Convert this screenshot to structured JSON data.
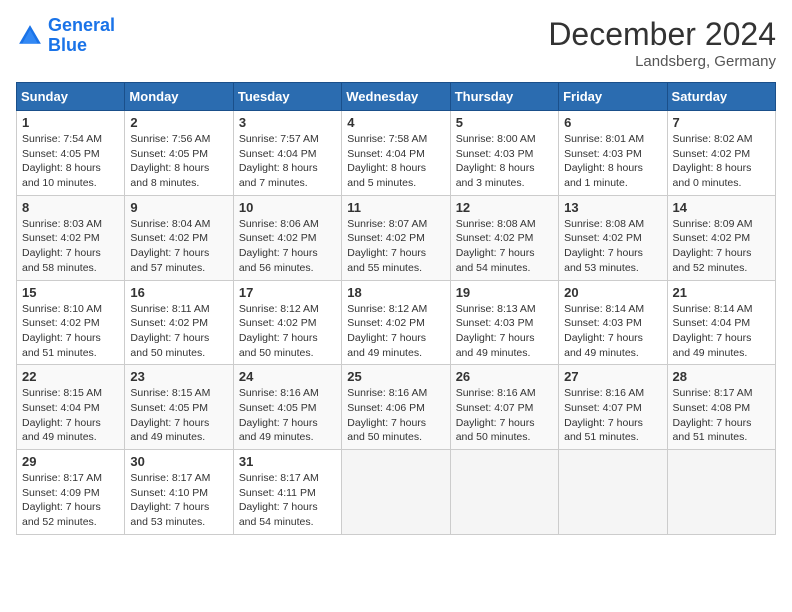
{
  "logo": {
    "line1": "General",
    "line2": "Blue"
  },
  "title": "December 2024",
  "location": "Landsberg, Germany",
  "days_header": [
    "Sunday",
    "Monday",
    "Tuesday",
    "Wednesday",
    "Thursday",
    "Friday",
    "Saturday"
  ],
  "weeks": [
    [
      {
        "num": "1",
        "sunrise": "7:54 AM",
        "sunset": "4:05 PM",
        "daylight": "8 hours and 10 minutes."
      },
      {
        "num": "2",
        "sunrise": "7:56 AM",
        "sunset": "4:05 PM",
        "daylight": "8 hours and 8 minutes."
      },
      {
        "num": "3",
        "sunrise": "7:57 AM",
        "sunset": "4:04 PM",
        "daylight": "8 hours and 7 minutes."
      },
      {
        "num": "4",
        "sunrise": "7:58 AM",
        "sunset": "4:04 PM",
        "daylight": "8 hours and 5 minutes."
      },
      {
        "num": "5",
        "sunrise": "8:00 AM",
        "sunset": "4:03 PM",
        "daylight": "8 hours and 3 minutes."
      },
      {
        "num": "6",
        "sunrise": "8:01 AM",
        "sunset": "4:03 PM",
        "daylight": "8 hours and 1 minute."
      },
      {
        "num": "7",
        "sunrise": "8:02 AM",
        "sunset": "4:02 PM",
        "daylight": "8 hours and 0 minutes."
      }
    ],
    [
      {
        "num": "8",
        "sunrise": "8:03 AM",
        "sunset": "4:02 PM",
        "daylight": "7 hours and 58 minutes."
      },
      {
        "num": "9",
        "sunrise": "8:04 AM",
        "sunset": "4:02 PM",
        "daylight": "7 hours and 57 minutes."
      },
      {
        "num": "10",
        "sunrise": "8:06 AM",
        "sunset": "4:02 PM",
        "daylight": "7 hours and 56 minutes."
      },
      {
        "num": "11",
        "sunrise": "8:07 AM",
        "sunset": "4:02 PM",
        "daylight": "7 hours and 55 minutes."
      },
      {
        "num": "12",
        "sunrise": "8:08 AM",
        "sunset": "4:02 PM",
        "daylight": "7 hours and 54 minutes."
      },
      {
        "num": "13",
        "sunrise": "8:08 AM",
        "sunset": "4:02 PM",
        "daylight": "7 hours and 53 minutes."
      },
      {
        "num": "14",
        "sunrise": "8:09 AM",
        "sunset": "4:02 PM",
        "daylight": "7 hours and 52 minutes."
      }
    ],
    [
      {
        "num": "15",
        "sunrise": "8:10 AM",
        "sunset": "4:02 PM",
        "daylight": "7 hours and 51 minutes."
      },
      {
        "num": "16",
        "sunrise": "8:11 AM",
        "sunset": "4:02 PM",
        "daylight": "7 hours and 50 minutes."
      },
      {
        "num": "17",
        "sunrise": "8:12 AM",
        "sunset": "4:02 PM",
        "daylight": "7 hours and 50 minutes."
      },
      {
        "num": "18",
        "sunrise": "8:12 AM",
        "sunset": "4:02 PM",
        "daylight": "7 hours and 49 minutes."
      },
      {
        "num": "19",
        "sunrise": "8:13 AM",
        "sunset": "4:03 PM",
        "daylight": "7 hours and 49 minutes."
      },
      {
        "num": "20",
        "sunrise": "8:14 AM",
        "sunset": "4:03 PM",
        "daylight": "7 hours and 49 minutes."
      },
      {
        "num": "21",
        "sunrise": "8:14 AM",
        "sunset": "4:04 PM",
        "daylight": "7 hours and 49 minutes."
      }
    ],
    [
      {
        "num": "22",
        "sunrise": "8:15 AM",
        "sunset": "4:04 PM",
        "daylight": "7 hours and 49 minutes."
      },
      {
        "num": "23",
        "sunrise": "8:15 AM",
        "sunset": "4:05 PM",
        "daylight": "7 hours and 49 minutes."
      },
      {
        "num": "24",
        "sunrise": "8:16 AM",
        "sunset": "4:05 PM",
        "daylight": "7 hours and 49 minutes."
      },
      {
        "num": "25",
        "sunrise": "8:16 AM",
        "sunset": "4:06 PM",
        "daylight": "7 hours and 50 minutes."
      },
      {
        "num": "26",
        "sunrise": "8:16 AM",
        "sunset": "4:07 PM",
        "daylight": "7 hours and 50 minutes."
      },
      {
        "num": "27",
        "sunrise": "8:16 AM",
        "sunset": "4:07 PM",
        "daylight": "7 hours and 51 minutes."
      },
      {
        "num": "28",
        "sunrise": "8:17 AM",
        "sunset": "4:08 PM",
        "daylight": "7 hours and 51 minutes."
      }
    ],
    [
      {
        "num": "29",
        "sunrise": "8:17 AM",
        "sunset": "4:09 PM",
        "daylight": "7 hours and 52 minutes."
      },
      {
        "num": "30",
        "sunrise": "8:17 AM",
        "sunset": "4:10 PM",
        "daylight": "7 hours and 53 minutes."
      },
      {
        "num": "31",
        "sunrise": "8:17 AM",
        "sunset": "4:11 PM",
        "daylight": "7 hours and 54 minutes."
      },
      null,
      null,
      null,
      null
    ]
  ],
  "labels": {
    "sunrise": "Sunrise:",
    "sunset": "Sunset:",
    "daylight": "Daylight:"
  }
}
